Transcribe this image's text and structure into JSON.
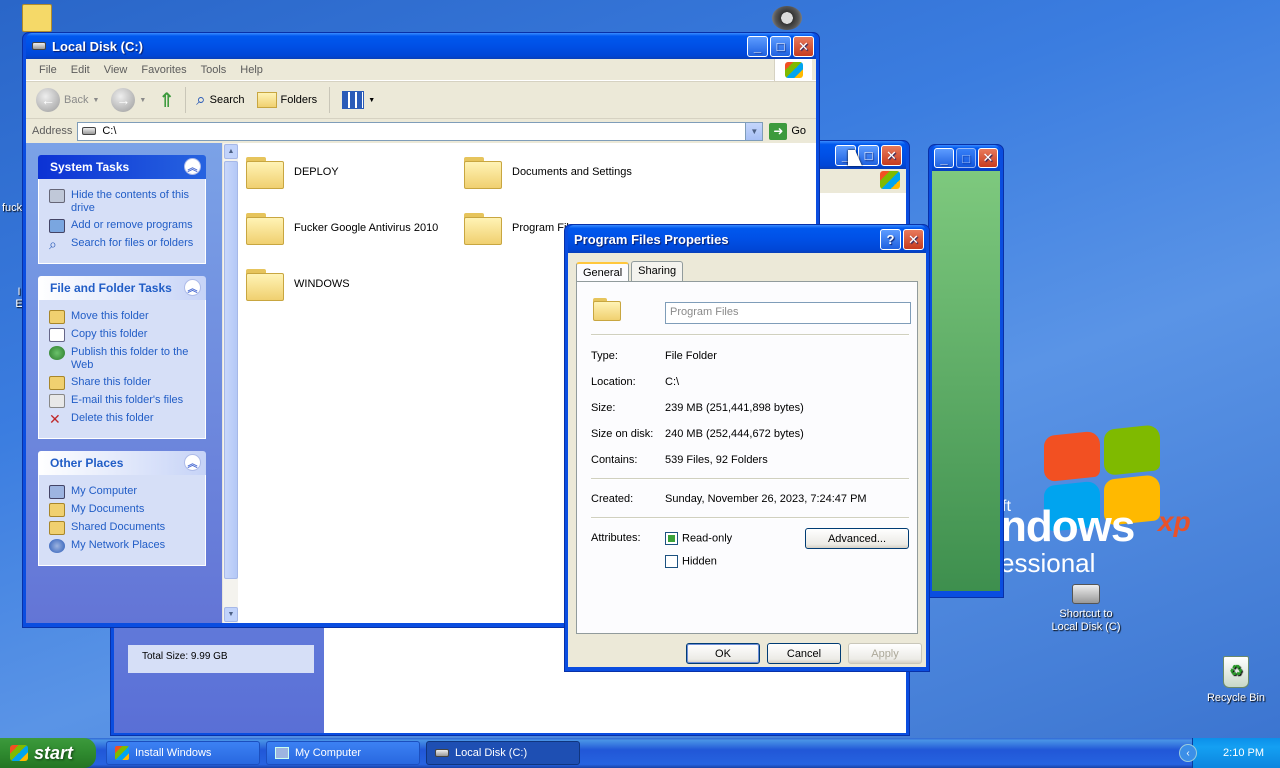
{
  "desktop": {
    "partial_label_left": "fuck",
    "partial_label_left2": "I\nE",
    "logo_ft": "ft",
    "logo_main": "ndows",
    "logo_xp": "xp",
    "logo_sub": "essional",
    "icons": [
      {
        "label": "Shortcut to\nLocal Disk (C)"
      },
      {
        "label": "Recycle Bin"
      }
    ],
    "behind_window_text": "Total Size: 9.99 GB"
  },
  "explorer": {
    "title": "Local Disk (C:)",
    "menu": [
      "File",
      "Edit",
      "View",
      "Favorites",
      "Tools",
      "Help"
    ],
    "toolbar": {
      "back": "Back",
      "search": "Search",
      "folders": "Folders"
    },
    "address_label": "Address",
    "address_value": "C:\\",
    "go_label": "Go",
    "system_tasks": {
      "title": "System Tasks",
      "items": [
        "Hide the contents of this drive",
        "Add or remove programs",
        "Search for files or folders"
      ]
    },
    "file_tasks": {
      "title": "File and Folder Tasks",
      "items": [
        "Move this folder",
        "Copy this folder",
        "Publish this folder to the Web",
        "Share this folder",
        "E-mail this folder's files",
        "Delete this folder"
      ]
    },
    "other_places": {
      "title": "Other Places",
      "items": [
        "My Computer",
        "My Documents",
        "Shared Documents",
        "My Network Places"
      ]
    },
    "files": [
      "DEPLOY",
      "Documents and Settings",
      "Fucker Google Antivirus 2010",
      "Program Fil",
      "WINDOWS"
    ]
  },
  "properties": {
    "title": "Program Files Properties",
    "tabs": [
      "General",
      "Sharing"
    ],
    "name_value": "Program Files",
    "type_label": "Type:",
    "type_value": "File Folder",
    "location_label": "Location:",
    "location_value": "C:\\",
    "size_label": "Size:",
    "size_value": "239 MB (251,441,898 bytes)",
    "size_on_disk_label": "Size on disk:",
    "size_on_disk_value": "240 MB (252,444,672 bytes)",
    "contains_label": "Contains:",
    "contains_value": "539 Files, 92 Folders",
    "created_label": "Created:",
    "created_value": "Sunday, November 26, 2023, 7:24:47 PM",
    "attributes_label": "Attributes:",
    "readonly_label": "Read-only",
    "hidden_label": "Hidden",
    "advanced_label": "Advanced...",
    "ok_label": "OK",
    "cancel_label": "Cancel",
    "apply_label": "Apply"
  },
  "taskbar": {
    "start_label": "start",
    "tasks": [
      "Install Windows",
      "My Computer",
      "Local Disk (C:)"
    ],
    "clock": "2:10 PM"
  }
}
